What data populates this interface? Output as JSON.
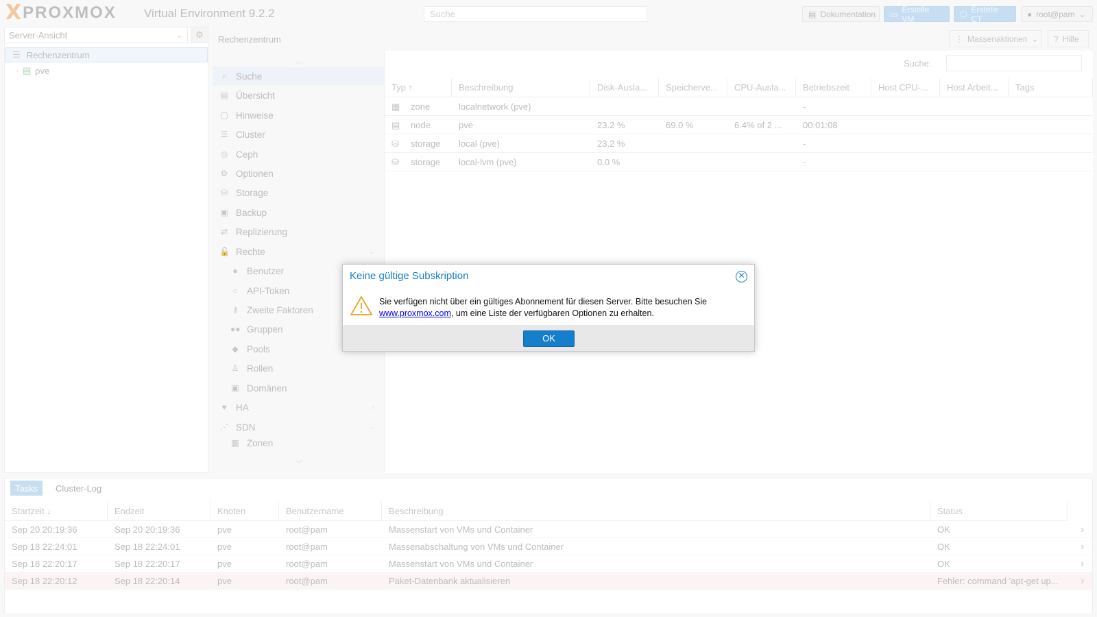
{
  "header": {
    "brand": "PROXMOX",
    "version": "Virtual Environment 9.2.2",
    "search_placeholder": "Suche",
    "doc_label": "Dokumentation",
    "create_vm_label": "Erstelle VM",
    "create_ct_label": "Erstelle CT",
    "user_label": "root@pam"
  },
  "tree": {
    "view_label": "Server-Ansicht",
    "datacenter_label": "Rechenzentrum",
    "node_label": "pve"
  },
  "breadcrumb": "Rechenzentrum",
  "toolbar": {
    "bulk_label": "Massenaktionen",
    "help_label": "Hilfe",
    "search_label": "Suche:"
  },
  "nav": [
    {
      "label": "Suche",
      "icon": "search-icon",
      "glyph": "⌕"
    },
    {
      "label": "Übersicht",
      "icon": "book-icon",
      "glyph": "▤"
    },
    {
      "label": "Hinweise",
      "icon": "note-icon",
      "glyph": "▢"
    },
    {
      "label": "Cluster",
      "icon": "server-icon",
      "glyph": "☰"
    },
    {
      "label": "Ceph",
      "icon": "ceph-icon",
      "glyph": "◎"
    },
    {
      "label": "Optionen",
      "icon": "gear-icon",
      "glyph": "⚙"
    },
    {
      "label": "Storage",
      "icon": "database-icon",
      "glyph": "⛁"
    },
    {
      "label": "Backup",
      "icon": "floppy-icon",
      "glyph": "▣"
    },
    {
      "label": "Replizierung",
      "icon": "retweet-icon",
      "glyph": "⇄"
    },
    {
      "label": "Rechte",
      "icon": "unlock-icon",
      "glyph": "🔓"
    },
    {
      "label": "Benutzer",
      "icon": "user-icon",
      "glyph": "●"
    },
    {
      "label": "API-Token",
      "icon": "user-outline-icon",
      "glyph": "○"
    },
    {
      "label": "Zweite Faktoren",
      "icon": "key-icon",
      "glyph": "⚷"
    },
    {
      "label": "Gruppen",
      "icon": "users-icon",
      "glyph": "●●"
    },
    {
      "label": "Pools",
      "icon": "tags-icon",
      "glyph": "◆"
    },
    {
      "label": "Rollen",
      "icon": "male-icon",
      "glyph": "♙"
    },
    {
      "label": "Domänen",
      "icon": "address-book-icon",
      "glyph": "▣"
    },
    {
      "label": "HA",
      "icon": "heartbeat-icon",
      "glyph": "♥"
    },
    {
      "label": "SDN",
      "icon": "sdn-icon",
      "glyph": "⋰"
    },
    {
      "label": "Zonen",
      "icon": "th-icon",
      "glyph": "▦"
    }
  ],
  "grid": {
    "columns": [
      "Typ ↑",
      "Beschreibung",
      "Disk-Ausla...",
      "Speicherve...",
      "CPU-Ausla...",
      "Betriebszeit",
      "Host CPU-...",
      "Host Arbeit...",
      "Tags"
    ],
    "rows": [
      {
        "type": "zone",
        "desc": "localnetwork (pve)",
        "disk": "",
        "mem": "",
        "cpu": "",
        "uptime": "-"
      },
      {
        "type": "node",
        "desc": "pve",
        "disk": "23.2 %",
        "mem": "69.0 %",
        "cpu": "6.4% of 2 ...",
        "uptime": "00:01:08"
      },
      {
        "type": "storage",
        "desc": "local (pve)",
        "disk": "23.2 %",
        "mem": "",
        "cpu": "",
        "uptime": "-"
      },
      {
        "type": "storage",
        "desc": "local-lvm (pve)",
        "disk": "0.0 %",
        "mem": "",
        "cpu": "",
        "uptime": "-"
      }
    ]
  },
  "dialog": {
    "title": "Keine gültige Subskription",
    "text_before": "Sie verfügen nicht über ein gültiges Abonnement für diesen Server. Bitte besuchen Sie",
    "link": "www.proxmox.com",
    "text_after": ", um eine Liste der verfügbaren Optionen zu erhalten.",
    "ok_label": "OK"
  },
  "tasks": {
    "tabs": [
      "Tasks",
      "Cluster-Log"
    ],
    "columns": [
      "Startzeit ↓",
      "Endzeit",
      "Knoten",
      "Benutzername",
      "Beschreibung",
      "Status"
    ],
    "rows": [
      {
        "start": "Sep 20 20:19:36",
        "end": "Sep 20 20:19:36",
        "node": "pve",
        "user": "root@pam",
        "desc": "Massenstart von VMs und Container",
        "status": "OK"
      },
      {
        "start": "Sep 18 22:24:01",
        "end": "Sep 18 22:24:01",
        "node": "pve",
        "user": "root@pam",
        "desc": "Massenabschaltung von VMs und Container",
        "status": "OK"
      },
      {
        "start": "Sep 18 22:20:17",
        "end": "Sep 18 22:20:17",
        "node": "pve",
        "user": "root@pam",
        "desc": "Massenstart von VMs und Container",
        "status": "OK"
      },
      {
        "start": "Sep 18 22:20:12",
        "end": "Sep 18 22:20:14",
        "node": "pve",
        "user": "root@pam",
        "desc": "Paket-Datenbank aktualisieren",
        "status": "Fehler: command 'apt-get up..."
      }
    ]
  }
}
